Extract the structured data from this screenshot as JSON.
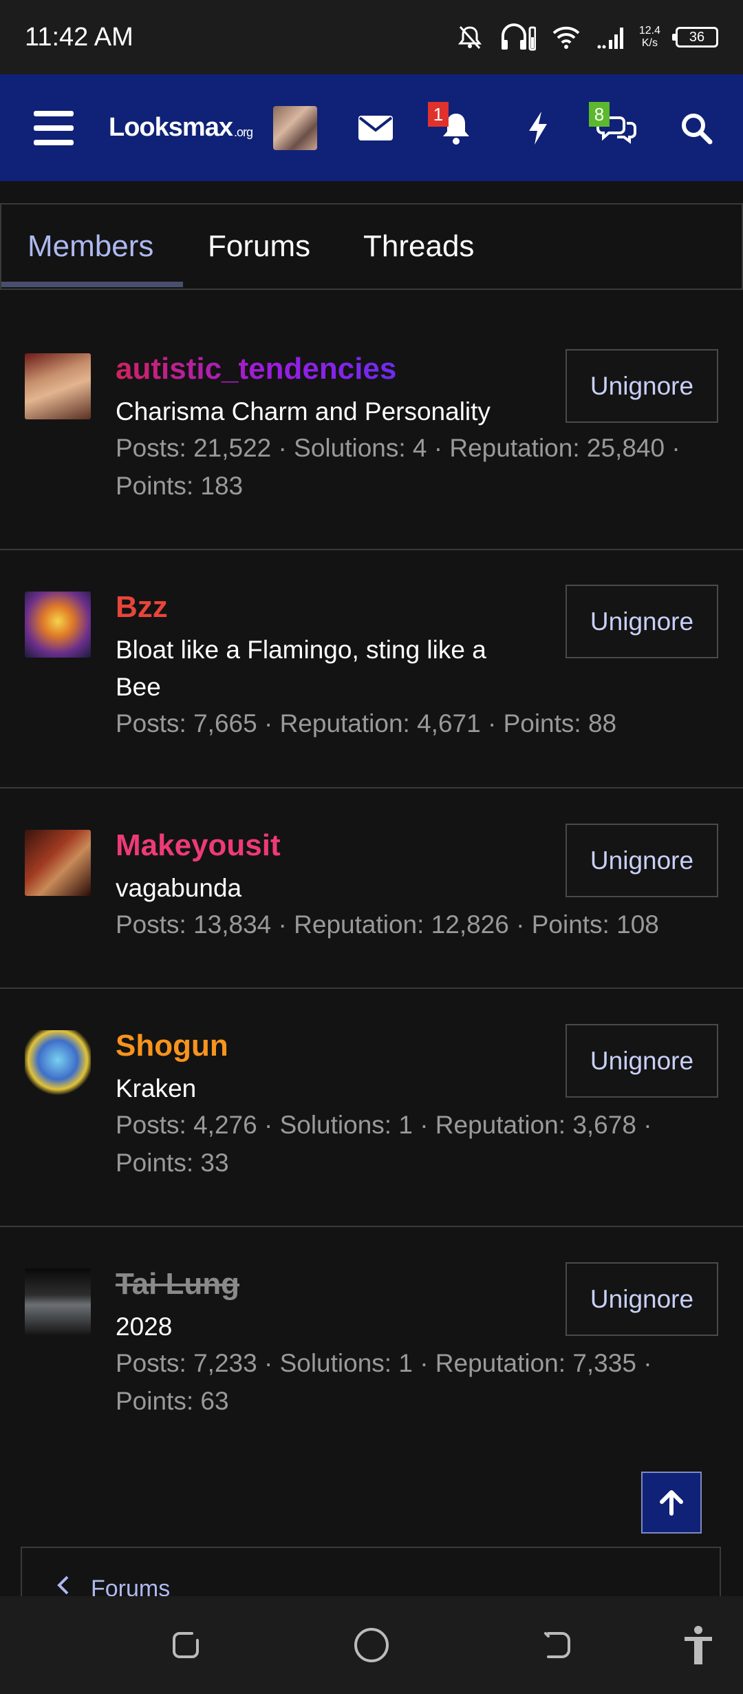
{
  "status_bar": {
    "time": "11:42 AM",
    "net_speed_value": "12.4",
    "net_speed_unit": "K/s",
    "battery": "36"
  },
  "topnav": {
    "logo_main": "Looksmax",
    "logo_suffix": ".org",
    "alerts_count": "1",
    "conversations_count": "8"
  },
  "tabs": {
    "members": "Members",
    "forums": "Forums",
    "threads": "Threads"
  },
  "members": [
    {
      "name": "autistic_tendencies",
      "title": "Charisma Charm and Personality",
      "stats": "Posts: 21,522 · Solutions: 4 · Reputation: 25,840 · Points: 183",
      "button": "Unignore"
    },
    {
      "name": "Bzz",
      "title": "Bloat like a Flamingo, sting like a Bee",
      "stats": "Posts: 7,665 · Reputation: 4,671 · Points: 88",
      "button": "Unignore"
    },
    {
      "name": "Makeyousit",
      "title": "vagabunda",
      "stats": "Posts: 13,834 · Reputation: 12,826 · Points: 108",
      "button": "Unignore"
    },
    {
      "name": "Shogun",
      "title": "Kraken",
      "stats": "Posts: 4,276 · Solutions: 1 · Reputation: 3,678 · Points: 33",
      "button": "Unignore"
    },
    {
      "name": "Tai Lung",
      "title": "2028",
      "stats": "Posts: 7,233 · Solutions: 1 · Reputation: 7,335 · Points: 63",
      "button": "Unignore"
    }
  ],
  "breadcrumb": {
    "label": "Forums"
  },
  "colors": {
    "nav_blue": "#0f2277",
    "tab_active": "#aeb9f0",
    "badge_red": "#e0312d",
    "badge_green": "#5cb82d"
  }
}
